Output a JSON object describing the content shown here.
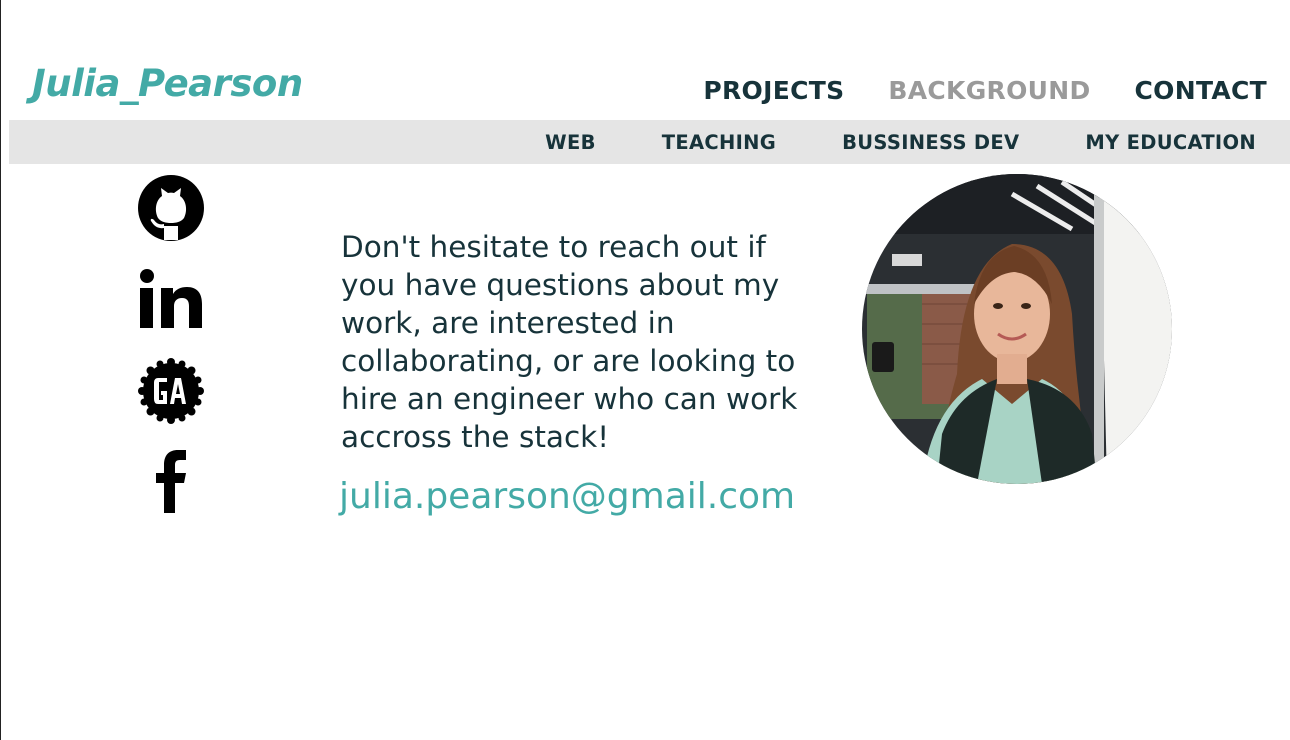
{
  "header": {
    "logo": "Julia_Pearson",
    "nav": [
      {
        "label": "PROJECTS"
      },
      {
        "label": "BACKGROUND"
      },
      {
        "label": "CONTACT"
      }
    ]
  },
  "subnav": {
    "items": [
      {
        "label": "WEB"
      },
      {
        "label": "TEACHING"
      },
      {
        "label": "BUSSINESS DEV"
      },
      {
        "label": "MY EDUCATION"
      }
    ]
  },
  "social": {
    "icons": [
      "github-icon",
      "linkedin-icon",
      "general-assembly-icon",
      "facebook-icon"
    ]
  },
  "contact": {
    "message": "Don't hesitate to reach out if you have questions about my work, are interested in collaborating, or are looking to hire an engineer who can work accross the stack!",
    "email": "julia.pearson@gmail.com"
  },
  "colors": {
    "accent": "#43aaa6",
    "text": "#17333a",
    "muted": "#9a9a9a",
    "subnav_bg": "#e5e5e5"
  }
}
